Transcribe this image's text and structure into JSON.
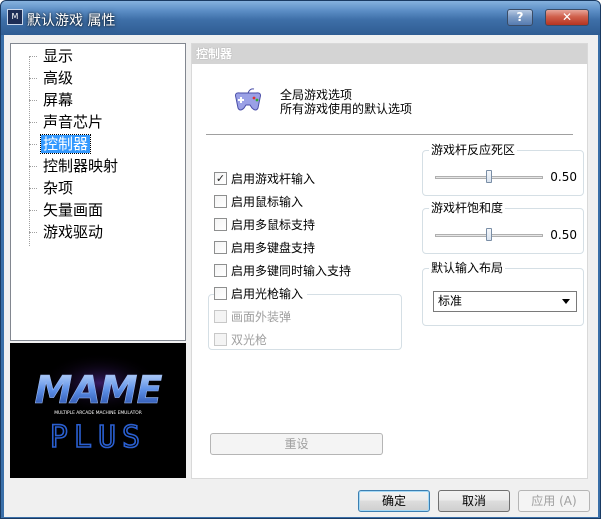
{
  "window": {
    "title": "默认游戏 属性",
    "app_icon": "mame-app-icon",
    "help_label": "?",
    "close_label": "✕"
  },
  "tree": {
    "items": [
      {
        "label": "显示",
        "selected": false
      },
      {
        "label": "高级",
        "selected": false
      },
      {
        "label": "屏幕",
        "selected": false
      },
      {
        "label": "声音芯片",
        "selected": false
      },
      {
        "label": "控制器",
        "selected": true
      },
      {
        "label": "控制器映射",
        "selected": false
      },
      {
        "label": "杂项",
        "selected": false
      },
      {
        "label": "矢量画面",
        "selected": false
      },
      {
        "label": "游戏驱动",
        "selected": false
      }
    ]
  },
  "logo": {
    "word_top": "MAME",
    "subtitle": "MULTIPLE ARCADE MACHINE EMULATOR",
    "word_bottom": "PLUS"
  },
  "panel": {
    "header": "控制器",
    "icon": "gamepad-icon",
    "desc_line1": "全局游戏选项",
    "desc_line2": "所有游戏使用的默认选项",
    "checkboxes": [
      {
        "label": "启用游戏杆输入",
        "checked": true,
        "enabled": true
      },
      {
        "label": "启用鼠标输入",
        "checked": false,
        "enabled": true
      },
      {
        "label": "启用多鼠标支持",
        "checked": false,
        "enabled": true
      },
      {
        "label": "启用多键盘支持",
        "checked": false,
        "enabled": true
      },
      {
        "label": "启用多键同时输入支持",
        "checked": false,
        "enabled": true
      }
    ],
    "lightgun": {
      "label": "启用光枪输入",
      "checked": false,
      "options": [
        {
          "label": "画面外装弹",
          "checked": false,
          "enabled": false
        },
        {
          "label": "双光枪",
          "checked": false,
          "enabled": false
        }
      ]
    },
    "deadzone": {
      "title": "游戏杆反应死区",
      "value": "0.50",
      "fraction": 0.5
    },
    "saturation": {
      "title": "游戏杆饱和度",
      "value": "0.50",
      "fraction": 0.5
    },
    "layout": {
      "title": "默认输入布局",
      "selected": "标准"
    },
    "reset_label": "重设"
  },
  "footer": {
    "ok_label": "确定",
    "cancel_label": "取消",
    "apply_label": "应用 (A)"
  },
  "colors": {
    "title_bar": "#3e6fa8",
    "selection": "#3399ff",
    "logo_blue": "#2a5fd0"
  }
}
